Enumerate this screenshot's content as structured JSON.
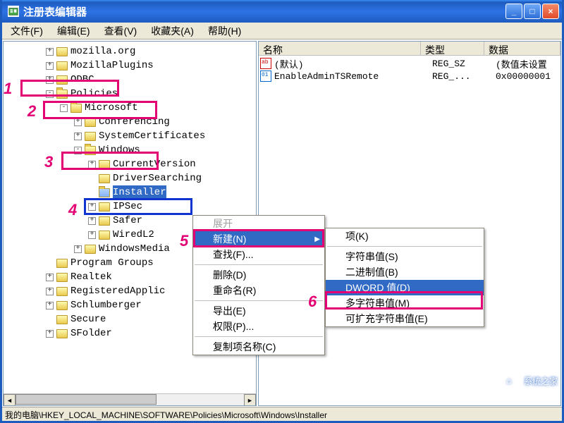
{
  "title": "注册表编辑器",
  "menus": {
    "file": "文件(F)",
    "edit": "编辑(E)",
    "view": "查看(V)",
    "fav": "收藏夹(A)",
    "help": "帮助(H)"
  },
  "columns": {
    "name": "名称",
    "type": "类型",
    "data": "数据"
  },
  "rows": [
    {
      "icon": "str",
      "name": "(默认)",
      "type": "REG_SZ",
      "data": "(数值未设置"
    },
    {
      "icon": "bin",
      "name": "EnableAdminTSRemote",
      "type": "REG_...",
      "data": "0x00000001"
    }
  ],
  "tree": {
    "mozilla_org": "mozilla.org",
    "mozilla_plugins": "MozillaPlugins",
    "odbc": "ODBC",
    "policies": "Policies",
    "microsoft": "Microsoft",
    "conferencing": "Conferencing",
    "system_certs": "SystemCertificates",
    "windows": "Windows",
    "current_version": "CurrentVersion",
    "driver_searching": "DriverSearching",
    "installer": "Installer",
    "ipsec": "IPSec",
    "safer": "Safer",
    "wiredl2": "WiredL2",
    "windows_media": "WindowsMedia",
    "program_groups": "Program Groups",
    "realtek": "Realtek",
    "registered_applic": "RegisteredApplic",
    "schlumberger": "Schlumberger",
    "secure": "Secure",
    "sfolder": "SFolder"
  },
  "ctx1": {
    "expand": "展开",
    "new": "新建(N)",
    "find": "查找(F)...",
    "delete": "删除(D)",
    "rename": "重命名(R)",
    "export": "导出(E)",
    "perm": "权限(P)...",
    "copykey": "复制项名称(C)"
  },
  "ctx2": {
    "key": "项(K)",
    "string": "字符串值(S)",
    "binary": "二进制值(B)",
    "dword": "DWORD 值(D)",
    "multistr": "多字符串值(M)",
    "expstr": "可扩充字符串值(E)"
  },
  "markers": {
    "m1": "1",
    "m2": "2",
    "m3": "3",
    "m4": "4",
    "m5": "5",
    "m6": "6"
  },
  "status": "我的电脑\\HKEY_LOCAL_MACHINE\\SOFTWARE\\Policies\\Microsoft\\Windows\\Installer",
  "watermark": "系统之家"
}
